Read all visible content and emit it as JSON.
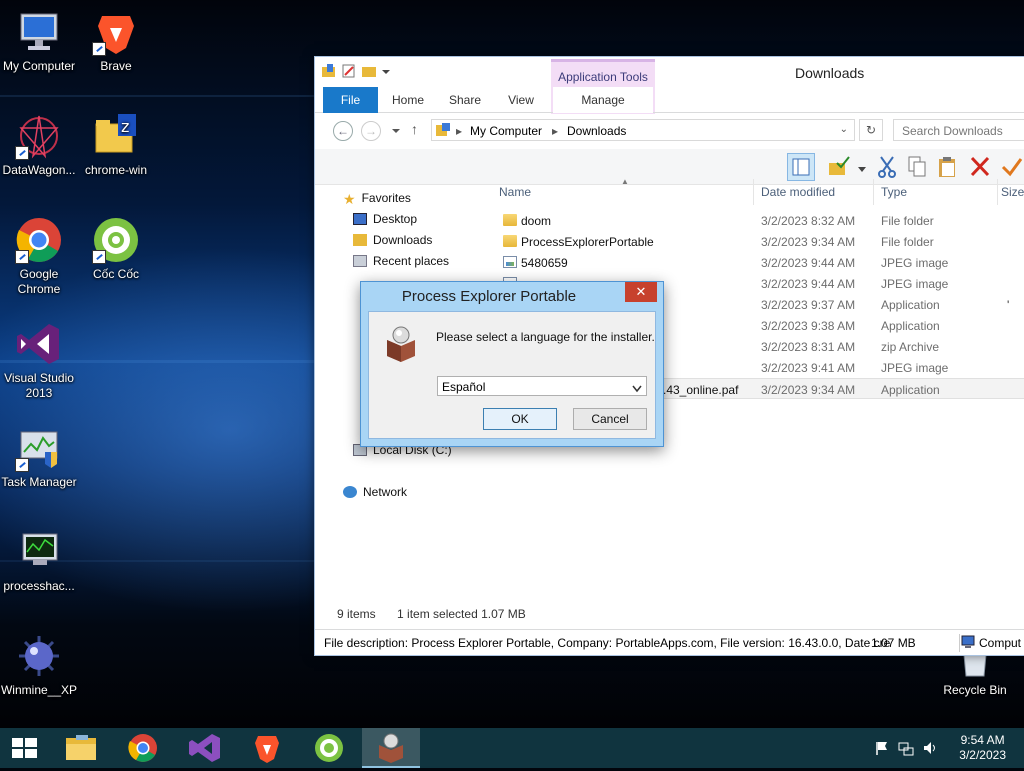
{
  "desktop": {
    "icons": [
      {
        "label": "My Computer"
      },
      {
        "label": "Brave"
      },
      {
        "label": "DataWagon..."
      },
      {
        "label": "chrome-win"
      },
      {
        "label": "Google Chrome"
      },
      {
        "label": "Cốc Cốc"
      },
      {
        "label": "Visual Studio 2013"
      },
      {
        "label": "Task Manager"
      },
      {
        "label": "processhac..."
      },
      {
        "label": "Winmine__XP"
      },
      {
        "label": "Recycle Bin"
      }
    ]
  },
  "explorer": {
    "title": "Downloads",
    "contextual_tab_group": "Application Tools",
    "tabs": [
      "File",
      "Home",
      "Share",
      "View",
      "Manage"
    ],
    "address": {
      "root": "My Computer",
      "current": "Downloads"
    },
    "search_placeholder": "Search Downloads",
    "nav": {
      "favorites": "Favorites",
      "desktop": "Desktop",
      "downloads": "Downloads",
      "recent": "Recent places",
      "local_disk": "Local Disk (C:)",
      "network": "Network"
    },
    "columns": {
      "name": "Name",
      "date": "Date modified",
      "type": "Type",
      "size": "Size"
    },
    "files": [
      {
        "name": "doom",
        "date": "3/2/2023 8:32 AM",
        "type": "File folder",
        "icon": "folder-icon"
      },
      {
        "name": "ProcessExplorerPortable",
        "date": "3/2/2023 9:34 AM",
        "type": "File folder",
        "icon": "folder-icon"
      },
      {
        "name": "5480659",
        "date": "3/2/2023 9:44 AM",
        "type": "JPEG image",
        "icon": "image-icon"
      },
      {
        "name": "",
        "date": "3/2/2023 9:44 AM",
        "type": "JPEG image",
        "icon": "image-icon"
      },
      {
        "name": "",
        "date": "3/2/2023 9:37 AM",
        "type": "Application",
        "icon": "app-icon"
      },
      {
        "name": "",
        "date": "3/2/2023 9:38 AM",
        "type": "Application",
        "icon": "app-icon"
      },
      {
        "name": "",
        "date": "3/2/2023 8:31 AM",
        "type": "zip Archive",
        "icon": "zip-icon"
      },
      {
        "name": "",
        "date": "3/2/2023 9:41 AM",
        "type": "JPEG image",
        "icon": "image-icon"
      },
      {
        "name": ".43_online.paf",
        "date": "3/2/2023 9:34 AM",
        "type": "Application",
        "icon": "app-icon"
      }
    ],
    "status": {
      "count": "9 items",
      "selected": "1 item selected  1.07 MB"
    },
    "details": {
      "description": "File description: Process Explorer Portable, Company: PortableApps.com, File version: 16.43.0.0, Date cre",
      "size": "1.07 MB",
      "location": "Comput"
    }
  },
  "dialog": {
    "title": "Process Explorer Portable",
    "close": "✕",
    "message": "Please select a language for the installer.",
    "selected_language": "Español",
    "ok": "OK",
    "cancel": "Cancel"
  },
  "taskbar": {
    "time": "9:54 AM",
    "date": "3/2/2023"
  }
}
